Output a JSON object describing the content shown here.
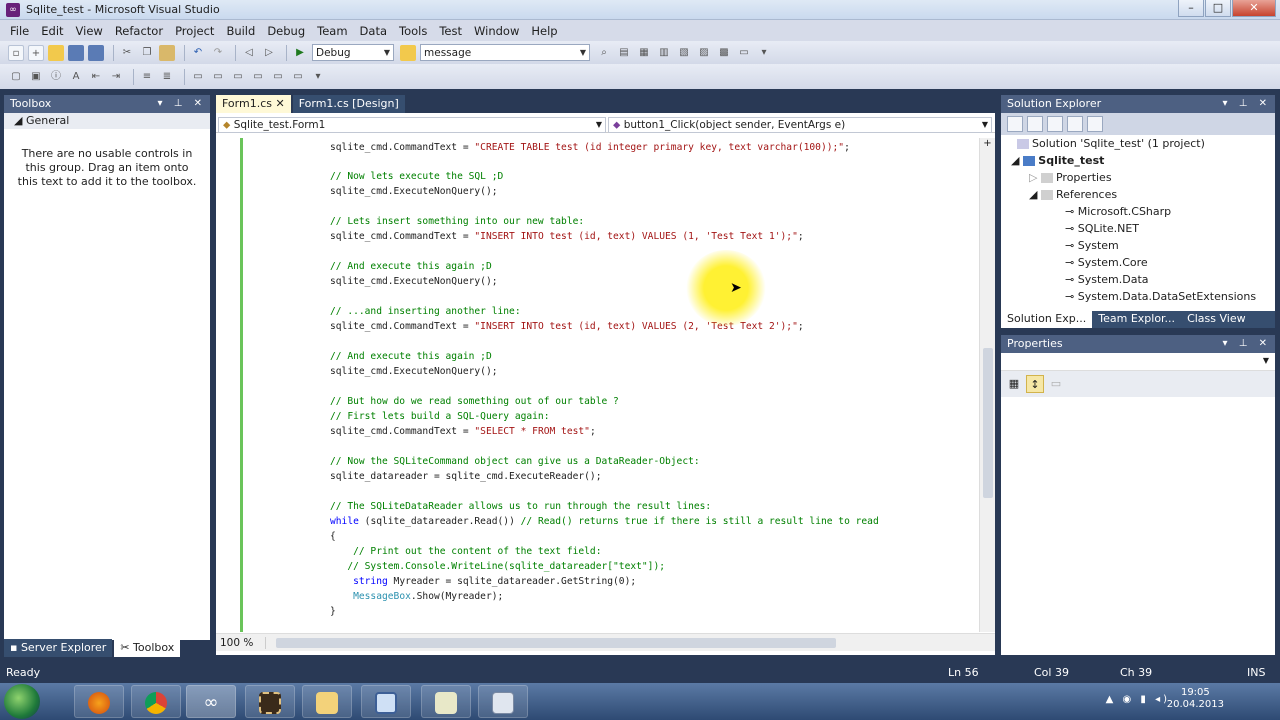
{
  "window": {
    "title": "Sqlite_test - Microsoft Visual Studio"
  },
  "menu": [
    "File",
    "Edit",
    "View",
    "Refactor",
    "Project",
    "Build",
    "Debug",
    "Team",
    "Data",
    "Tools",
    "Test",
    "Window",
    "Help"
  ],
  "toolbar": {
    "config_value": "Debug",
    "find_value": "message"
  },
  "toolbox": {
    "title": "Toolbox",
    "group": "General",
    "message": "There are no usable controls in this group. Drag an item onto this text to add it to the toolbox.",
    "bottom_tabs": [
      "Server Explorer",
      "Toolbox"
    ]
  },
  "editor": {
    "tabs": [
      "Form1.cs",
      "Form1.cs [Design]"
    ],
    "nav_class": "Sqlite_test.Form1",
    "nav_member": "button1_Click(object sender, EventArgs e)",
    "zoom": "100 %"
  },
  "code": [
    {
      "parts": [
        {
          "t": "sqlite_cmd.CommandText = ",
          "c": ""
        },
        {
          "t": "\"CREATE TABLE test (id integer primary key, text varchar(100));\"",
          "c": "str"
        },
        {
          "t": ";",
          "c": ""
        }
      ]
    },
    {
      "parts": [
        {
          "t": "// Now lets execute the SQL ;D",
          "c": "cmt"
        }
      ]
    },
    {
      "parts": [
        {
          "t": "sqlite_cmd.ExecuteNonQuery();",
          "c": ""
        }
      ]
    },
    {
      "parts": [
        {
          "t": "// Lets insert something into our new table:",
          "c": "cmt"
        }
      ]
    },
    {
      "parts": [
        {
          "t": "sqlite_cmd.CommandText = ",
          "c": ""
        },
        {
          "t": "\"INSERT INTO test (id, text) VALUES (1, 'Test Text 1');\"",
          "c": "str"
        },
        {
          "t": ";",
          "c": ""
        }
      ]
    },
    {
      "parts": [
        {
          "t": "// And execute this again ;D",
          "c": "cmt"
        }
      ]
    },
    {
      "parts": [
        {
          "t": "sqlite_cmd.ExecuteNonQuery();",
          "c": ""
        }
      ]
    },
    {
      "parts": [
        {
          "t": "// ...and inserting another line:",
          "c": "cmt"
        }
      ]
    },
    {
      "parts": [
        {
          "t": "sqlite_cmd.CommandText = ",
          "c": ""
        },
        {
          "t": "\"INSERT INTO test (id, text) VALUES (2, 'Test Text 2');\"",
          "c": "str"
        },
        {
          "t": ";",
          "c": ""
        }
      ]
    },
    {
      "parts": [
        {
          "t": "// And execute this again ;D",
          "c": "cmt"
        }
      ]
    },
    {
      "parts": [
        {
          "t": "sqlite_cmd.ExecuteNonQuery();",
          "c": ""
        }
      ]
    },
    {
      "parts": [
        {
          "t": "// But how do we read something out of our table ?",
          "c": "cmt"
        }
      ]
    },
    {
      "parts": [
        {
          "t": "// First lets build a SQL-Query again:",
          "c": "cmt"
        }
      ]
    },
    {
      "parts": [
        {
          "t": "sqlite_cmd.CommandText = ",
          "c": ""
        },
        {
          "t": "\"SELECT * FROM test\"",
          "c": "str"
        },
        {
          "t": ";",
          "c": ""
        }
      ]
    },
    {
      "parts": [
        {
          "t": "// Now the SQLiteCommand object can give us a DataReader-Object:",
          "c": "cmt"
        }
      ]
    },
    {
      "parts": [
        {
          "t": "sqlite_datareader = sqlite_cmd.ExecuteReader();",
          "c": ""
        }
      ]
    },
    {
      "parts": [
        {
          "t": "// The SQLiteDataReader allows us to run through the result lines:",
          "c": "cmt"
        }
      ]
    },
    {
      "parts": [
        {
          "t": "while",
          "c": "kw"
        },
        {
          "t": " (sqlite_datareader.Read()) ",
          "c": ""
        },
        {
          "t": "// Read() returns true if there is still a result line to read",
          "c": "cmt"
        }
      ]
    },
    {
      "parts": [
        {
          "t": "{",
          "c": ""
        }
      ]
    },
    {
      "parts": [
        {
          "t": "    // Print out the content of the text field:",
          "c": "cmt"
        }
      ]
    },
    {
      "parts": [
        {
          "t": "   // System.Console.WriteLine(sqlite_datareader[\"text\"]);",
          "c": "cmt"
        }
      ]
    },
    {
      "parts": [
        {
          "t": "    ",
          "c": ""
        },
        {
          "t": "string",
          "c": "kw"
        },
        {
          "t": " Myreader = sqlite_datareader.GetString(0);",
          "c": ""
        }
      ]
    },
    {
      "parts": [
        {
          "t": "    ",
          "c": ""
        },
        {
          "t": "MessageBox",
          "c": "cls"
        },
        {
          "t": ".Show(Myreader);",
          "c": ""
        }
      ]
    },
    {
      "parts": [
        {
          "t": "}",
          "c": ""
        }
      ]
    }
  ],
  "solution_explorer": {
    "title": "Solution Explorer",
    "items": [
      "Solution 'Sqlite_test' (1 project)",
      "Sqlite_test",
      "Properties",
      "References",
      "Microsoft.CSharp",
      "SQLite.NET",
      "System",
      "System.Core",
      "System.Data",
      "System.Data.DataSetExtensions"
    ],
    "bottom_tabs": [
      "Solution Exp...",
      "Team Explor...",
      "Class View"
    ]
  },
  "properties": {
    "title": "Properties"
  },
  "status": {
    "text": "Ready",
    "ln": "Ln 56",
    "col": "Col 39",
    "ch": "Ch 39",
    "mode": "INS"
  },
  "taskbar": {
    "time": "19:05",
    "date": "20.04.2013"
  }
}
